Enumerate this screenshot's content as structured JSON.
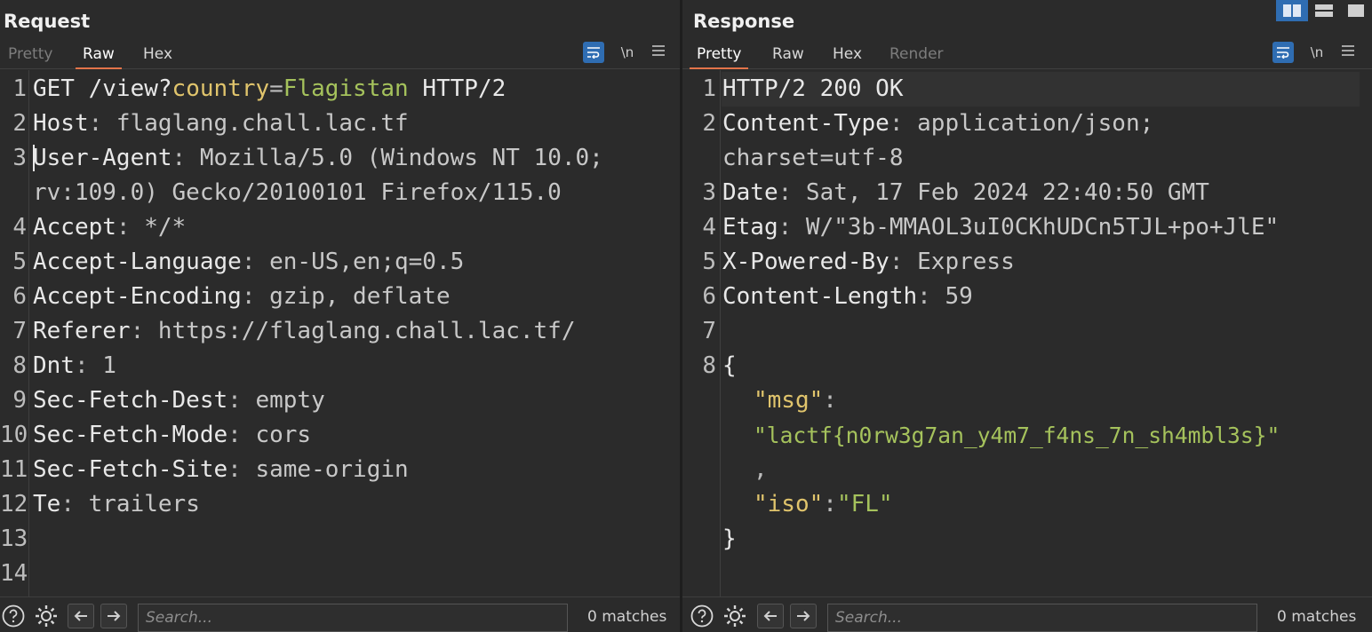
{
  "request": {
    "title": "Request",
    "tabs": [
      {
        "label": "Pretty",
        "state": "dim"
      },
      {
        "label": "Raw",
        "state": "active"
      },
      {
        "label": "Hex",
        "state": "normal"
      }
    ],
    "newline_label": "\\n",
    "line_numbers": [
      "1",
      "2",
      "3",
      "",
      "4",
      "5",
      "6",
      "7",
      "8",
      "9",
      "10",
      "11",
      "12",
      "13",
      "14"
    ],
    "lines": {
      "l1": {
        "method": "GET",
        "path": " /view?",
        "param": "country",
        "eq": "=",
        "value": "Flagistan",
        "proto": " HTTP/2"
      },
      "l2": {
        "key": "Host",
        "value": " flaglang.chall.lac.tf"
      },
      "l3": {
        "key": "User-Agent",
        "value": " Mozilla/5.0 (Windows NT 10.0;"
      },
      "l3b": {
        "value": "rv:109.0) Gecko/20100101 Firefox/115.0"
      },
      "l4": {
        "key": "Accept",
        "value": " */*"
      },
      "l5": {
        "key": "Accept-Language",
        "value": " en-US,en;q=0.5"
      },
      "l6": {
        "key": "Accept-Encoding",
        "value": " gzip, deflate"
      },
      "l7": {
        "key": "Referer",
        "value": " https://flaglang.chall.lac.tf/"
      },
      "l8": {
        "key": "Dnt",
        "value": " 1"
      },
      "l9": {
        "key": "Sec-Fetch-Dest",
        "value": " empty"
      },
      "l10": {
        "key": "Sec-Fetch-Mode",
        "value": " cors"
      },
      "l11": {
        "key": "Sec-Fetch-Site",
        "value": " same-origin"
      },
      "l12": {
        "key": "Te",
        "value": " trailers"
      }
    },
    "search": {
      "placeholder": "Search...",
      "matches": "0 matches"
    }
  },
  "response": {
    "title": "Response",
    "tabs": [
      {
        "label": "Pretty",
        "state": "active"
      },
      {
        "label": "Raw",
        "state": "normal"
      },
      {
        "label": "Hex",
        "state": "normal"
      },
      {
        "label": "Render",
        "state": "dim"
      }
    ],
    "newline_label": "\\n",
    "line_numbers": [
      "1",
      "2",
      "",
      "3",
      "4",
      "5",
      "6",
      "7",
      "8"
    ],
    "lines": {
      "l1": {
        "status": "HTTP/2 200 OK"
      },
      "l2": {
        "key": "Content-Type",
        "value": " application/json;"
      },
      "l2b": {
        "value": "charset=utf-8"
      },
      "l3": {
        "key": "Date",
        "value": " Sat, 17 Feb 2024 22:40:50 GMT"
      },
      "l4": {
        "key": "Etag",
        "value": " W/\"3b-MMAOL3uI0CKhUDCn5TJL+po+JlE\""
      },
      "l5": {
        "key": "X-Powered-By",
        "value": " Express"
      },
      "l6": {
        "key": "Content-Length",
        "value": " 59"
      },
      "l8_open": "{",
      "msg_key": "\"msg\"",
      "msg_colon": ":",
      "msg_value": "\"lactf{n0rw3g7an_y4m7_f4ns_7n_sh4mbl3s}\"",
      "comma": ",",
      "iso_key": "\"iso\"",
      "iso_colon": ":",
      "iso_value": "\"FL\"",
      "close": "}"
    },
    "search": {
      "placeholder": "Search...",
      "matches": "0 matches"
    }
  },
  "colors": {
    "accent": "#e3744a",
    "toggle": "#2f6db2",
    "string": "#a5c25c",
    "json_key": "#e0c46c"
  }
}
